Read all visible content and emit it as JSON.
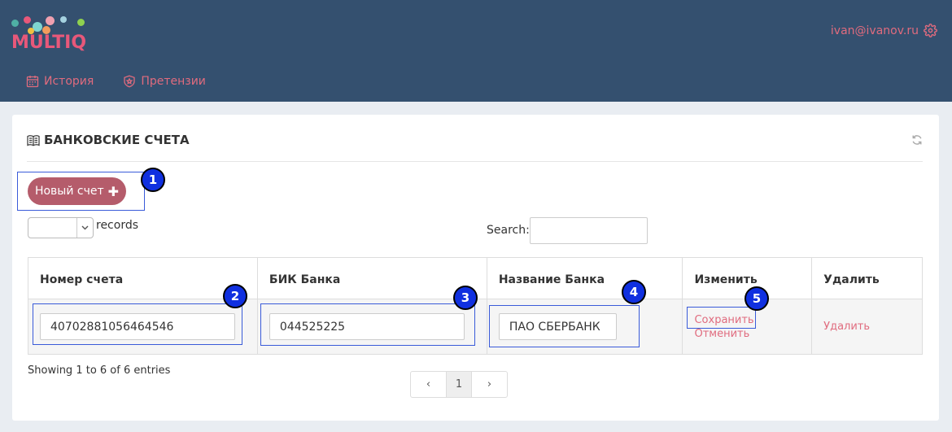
{
  "brand": {
    "logo_text": "MULTIQ"
  },
  "user": {
    "email": "ivan@ivanov.ru"
  },
  "nav": [
    {
      "label": "История",
      "icon": "calendar-icon"
    },
    {
      "label": "Претензии",
      "icon": "shield-icon"
    }
  ],
  "card": {
    "title": "БАНКОВСКИЕ СЧЕТА"
  },
  "toolbar": {
    "new_label": "Новый счет"
  },
  "table_controls": {
    "length_value": "",
    "records_label": "records",
    "search_label": "Search:",
    "search_value": ""
  },
  "table": {
    "headers": [
      "Номер счета",
      "БИК Банка",
      "Название Банка",
      "Изменить",
      "Удалить"
    ],
    "row": {
      "account": "40702881056464546",
      "bik": "044525225",
      "bank_name": "ПАО СБЕРБАНК",
      "save_label": "Сохранить",
      "cancel_label": "Отменить",
      "delete_label": "Удалить"
    }
  },
  "footer": {
    "showing": "Showing 1 to 6 of 6 entries",
    "prev": "‹",
    "page": "1",
    "next": "›"
  },
  "annotations": [
    "1",
    "2",
    "3",
    "4",
    "5"
  ],
  "colors": {
    "topbar": "#34506f",
    "accent": "#e06b7e",
    "button": "#b55c6b",
    "badge": "#1030e0"
  }
}
